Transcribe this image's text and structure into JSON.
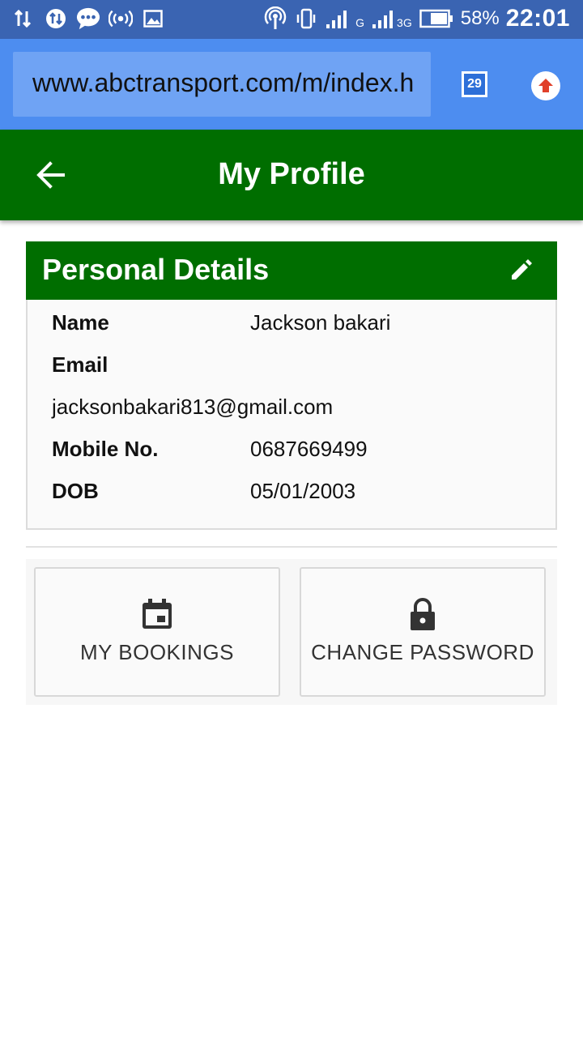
{
  "status_bar": {
    "battery_percent": "58%",
    "time": "22:01",
    "network_labels": [
      "G",
      "3G"
    ]
  },
  "browser": {
    "url": "www.abctransport.com/m/index.h",
    "tab_count": "29"
  },
  "app_bar": {
    "title": "My Profile"
  },
  "personal_details": {
    "title": "Personal Details",
    "name_label": "Name",
    "name_value": "Jackson bakari",
    "email_label": "Email",
    "email_value": "jacksonbakari813@gmail.com",
    "mobile_label": "Mobile No.",
    "mobile_value": "0687669499",
    "dob_label": "DOB",
    "dob_value": "05/01/2003"
  },
  "actions": {
    "bookings_label": "MY BOOKINGS",
    "change_password_label": "CHANGE PASSWORD"
  },
  "colors": {
    "status_bar": "#3a64b2",
    "browser_bar": "#4d8df0",
    "app_green": "#006e00"
  }
}
